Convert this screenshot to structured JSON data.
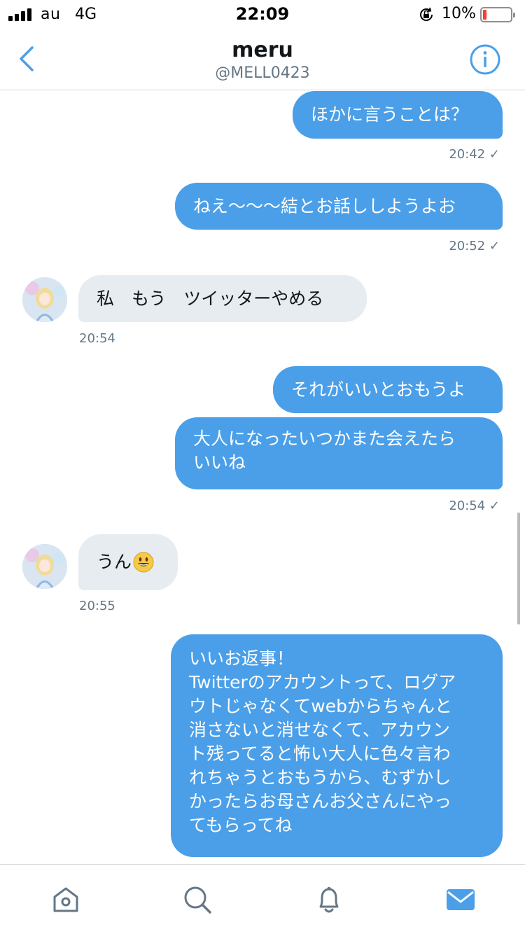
{
  "status_bar": {
    "carrier": "au",
    "network": "4G",
    "time": "22:09",
    "battery_percent": "10%",
    "battery_level": 0.1,
    "battery_color": "#ff3b30",
    "icons": [
      "signal-icon",
      "orientation-lock-icon",
      "battery-icon"
    ]
  },
  "header": {
    "title": "meru",
    "handle": "@MELL0423",
    "icons": [
      "back-chevron-icon",
      "info-icon"
    ],
    "accent_color": "#4a9fe8"
  },
  "messages": [
    {
      "direction": "outgoing",
      "text": "ほかに言うことは？",
      "time": "20:42 ✓"
    },
    {
      "direction": "outgoing",
      "text": "ねえ〜〜〜結とお話ししようよお",
      "time": "20:52 ✓"
    },
    {
      "direction": "incoming",
      "text": "私　もう　ツイッターやめる",
      "time": "20:54"
    },
    {
      "direction": "outgoing",
      "text": "それがいいとおもうよ"
    },
    {
      "direction": "outgoing",
      "lines": [
        "大人になったいつかまた会えたら",
        "いいね"
      ],
      "time": "20:54 ✓"
    },
    {
      "direction": "incoming",
      "text": "うん",
      "emoji": "smiley-emoji",
      "time": "20:55"
    },
    {
      "direction": "outgoing",
      "lines": [
        "いいお返事！",
        "Twitterのアカウントって、ログア",
        "ウトじゃなくてwebからちゃんと",
        "消さないと消せなくて、アカウン",
        "ト残ってると怖い大人に色々言わ",
        "れちゃうとおもうから、むずかし",
        "かったらお母さんお父さんにやっ",
        "てもらってね"
      ]
    }
  ],
  "tabbar": {
    "tabs": [
      {
        "name": "home-icon",
        "active": false
      },
      {
        "name": "search-icon",
        "active": false
      },
      {
        "name": "notifications-icon",
        "active": false
      },
      {
        "name": "messages-icon",
        "active": true
      }
    ],
    "active_color": "#4a9fe8",
    "inactive_color": "#657786"
  }
}
